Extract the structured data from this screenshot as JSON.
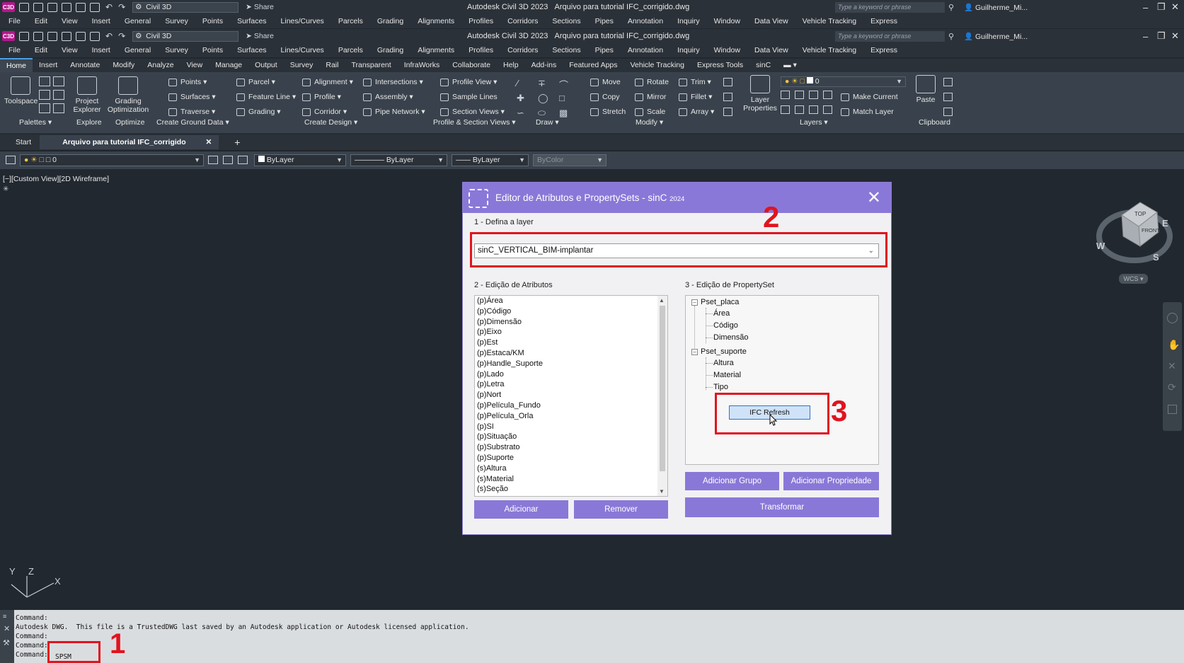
{
  "app": {
    "logo": "C3D",
    "workspace": "Civil 3D",
    "share_label": "Share",
    "title": "Autodesk Civil 3D 2023",
    "file": "Arquivo para tutorial IFC_corrigido.dwg",
    "search_placeholder": "Type a keyword or phrase",
    "user": "Guilherme_Mi..."
  },
  "menu": [
    "File",
    "Edit",
    "View",
    "Insert",
    "General",
    "Survey",
    "Points",
    "Surfaces",
    "Lines/Curves",
    "Parcels",
    "Grading",
    "Alignments",
    "Profiles",
    "Corridors",
    "Sections",
    "Pipes",
    "Annotation",
    "Inquiry",
    "Window",
    "Data View",
    "Vehicle Tracking",
    "Express"
  ],
  "ribbon_tabs": [
    "Home",
    "Insert",
    "Annotate",
    "Modify",
    "Analyze",
    "View",
    "Manage",
    "Output",
    "Survey",
    "Rail",
    "Transparent",
    "InfraWorks",
    "Collaborate",
    "Help",
    "Add-ins",
    "Featured Apps",
    "Vehicle Tracking",
    "Express Tools",
    "sinC"
  ],
  "ribbon": {
    "toolspace": "Toolspace",
    "project_explorer": [
      "Project",
      "Explorer"
    ],
    "grading_optimization": [
      "Grading",
      "Optimization"
    ],
    "points": "Points",
    "surfaces": "Surfaces",
    "traverse": "Traverse",
    "parcel": "Parcel",
    "feature_line": "Feature Line",
    "grading": "Grading",
    "alignment": "Alignment",
    "profile": "Profile",
    "corridor": "Corridor",
    "intersections": "Intersections",
    "assembly": "Assembly",
    "pipe_network": "Pipe Network",
    "profile_view": "Profile View",
    "sample_lines": "Sample Lines",
    "section_views": "Section Views",
    "move": "Move",
    "copy": "Copy",
    "stretch": "Stretch",
    "rotate": "Rotate",
    "mirror": "Mirror",
    "scale": "Scale",
    "trim": "Trim",
    "fillet": "Fillet",
    "array": "Array",
    "layer_properties": [
      "Layer",
      "Properties"
    ],
    "layer_value": "0",
    "make_current": "Make Current",
    "match_layer": "Match Layer",
    "paste": "Paste",
    "panels": [
      "Palettes",
      "Explore",
      "Optimize",
      "Create Ground Data",
      "Create Design",
      "Profile & Section Views",
      "Draw",
      "Modify",
      "Layers",
      "Clipboard"
    ]
  },
  "doc_tabs": {
    "start": "Start",
    "current": "Arquivo para tutorial IFC_corrigido"
  },
  "props": {
    "layer": "0",
    "color": "ByLayer",
    "linetype": "ByLayer",
    "lineweight": "ByLayer",
    "plotstyle": "ByColor"
  },
  "viewport": {
    "label": "[−][Custom View][2D Wireframe]"
  },
  "viewcube": {
    "top": "TOP",
    "front": "FRONT",
    "west": "W",
    "south": "S",
    "east": "E",
    "wcs": "WCS"
  },
  "ucs": {
    "y": "Y",
    "z": "Z",
    "x": "X"
  },
  "command": {
    "lines": [
      "Command:",
      "Autodesk DWG.  This file is a TrustedDWG last saved by an Autodesk application or Autodesk licensed application.",
      "Command:",
      "Command:",
      "Command:"
    ],
    "typed": "SPSM"
  },
  "dialog": {
    "title": "Editor de Atributos e PropertySets - sinC",
    "title_year": "2024",
    "close": "✕",
    "section1": "1 - Defina a layer",
    "layer": "sinC_VERTICAL_BIM-implantar",
    "section2": "2 - Edição de Atributos",
    "attributes": [
      "(p)Área",
      "(p)Código",
      "(p)Dimensão",
      "(p)Eixo",
      "(p)Est",
      "(p)Estaca/KM",
      "(p)Handle_Suporte",
      "(p)Lado",
      "(p)Letra",
      "(p)Nort",
      "(p)Película_Fundo",
      "(p)Película_Orla",
      "(p)SI",
      "(p)Situação",
      "(p)Substrato",
      "(p)Suporte",
      "(s)Altura",
      "(s)Material",
      "(s)Seção"
    ],
    "section3": "3 - Edição de PropertySet",
    "psets": [
      {
        "name": "Pset_placa",
        "props": [
          "Área",
          "Código",
          "Dimensão"
        ]
      },
      {
        "name": "Pset_suporte",
        "props": [
          "Altura",
          "Material",
          "Tipo"
        ]
      }
    ],
    "ifc_refresh": "IFC Refresh",
    "btn_add": "Adicionar",
    "btn_remove": "Remover",
    "btn_add_group": "Adicionar Grupo",
    "btn_add_prop": "Adicionar Propriedade",
    "btn_transform": "Transformar"
  },
  "annotations": [
    "1",
    "2",
    "3"
  ],
  "colors": {
    "accent": "#8a78d8",
    "highlight": "#e0141e",
    "background": "#212830"
  }
}
